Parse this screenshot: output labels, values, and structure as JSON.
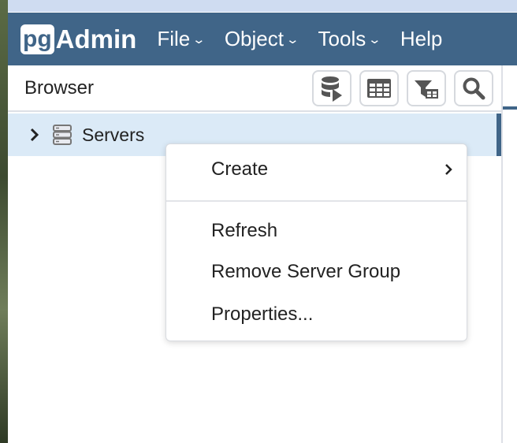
{
  "app": {
    "logo_pg": "pg",
    "logo_admin": "Admin"
  },
  "nav": {
    "items": [
      {
        "label": "File"
      },
      {
        "label": "Object"
      },
      {
        "label": "Tools"
      },
      {
        "label": "Help"
      }
    ]
  },
  "browser": {
    "title": "Browser",
    "toolbar": [
      {
        "icon": "query-tool-icon"
      },
      {
        "icon": "view-data-icon"
      },
      {
        "icon": "filtered-rows-icon"
      },
      {
        "icon": "search-objects-icon"
      }
    ]
  },
  "tree": {
    "node_label": "Servers"
  },
  "context_menu": {
    "items": [
      {
        "label": "Create"
      },
      {
        "label": "Refresh"
      },
      {
        "label": "Remove Server Group"
      },
      {
        "label": "Properties..."
      }
    ]
  },
  "colors": {
    "navbar": "#406588",
    "selected_row": "#dbeaf7"
  }
}
